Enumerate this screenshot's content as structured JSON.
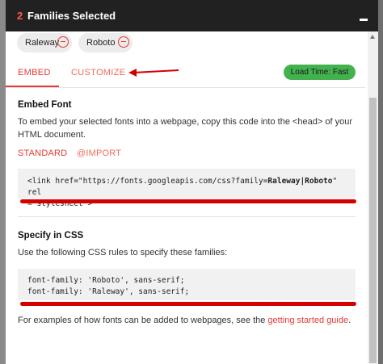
{
  "header": {
    "count": "2",
    "title": "Families Selected"
  },
  "chips": [
    {
      "label": "Raleway"
    },
    {
      "label": "Roboto"
    }
  ],
  "tabs": {
    "embed": "EMBED",
    "customize": "CUSTOMIZE"
  },
  "load_time": "Load Time: Fast",
  "embed_section": {
    "title": "Embed Font",
    "description": "To embed your selected fonts into a webpage, copy this code into the <head> of your HTML document.",
    "subtab_standard": "STANDARD",
    "subtab_import": "@IMPORT",
    "code_part1": "<link href=\"https://fonts.googleapis.com/css?family=",
    "code_bold": "Raleway|Roboto",
    "code_part2": "\" rel",
    "code_line2": "=\"stylesheet\">"
  },
  "css_section": {
    "title": "Specify in CSS",
    "description": "Use the following CSS rules to specify these families:",
    "rule1": "font-family: 'Roboto', sans-serif;",
    "rule2": "font-family: 'Raleway', sans-serif;"
  },
  "footer": {
    "text": "For examples of how fonts can be added to webpages, see the ",
    "link": "getting started guide",
    "end": "."
  },
  "colors": {
    "accent": "#e53935",
    "header_bg": "#212121",
    "load_badge": "#42b14e",
    "annotation": "#d40000"
  },
  "icons": [
    "remove-circle-icon",
    "minimize-icon",
    "annotation-arrow-icon",
    "scroll-up-icon"
  ]
}
